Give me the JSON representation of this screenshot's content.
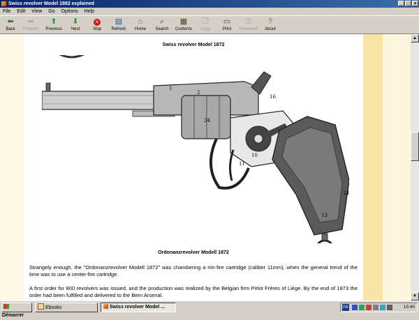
{
  "window": {
    "title": "Swiss revolver Model 1882 explained"
  },
  "menu": [
    "File",
    "Edit",
    "View",
    "Go",
    "Options",
    "Help"
  ],
  "toolbar": [
    {
      "label": "Back",
      "icon": "arrow-left-icon",
      "enabled": true
    },
    {
      "label": "Forward",
      "icon": "arrow-right-icon",
      "enabled": false
    },
    {
      "label": "Previous",
      "icon": "arrow-up-icon",
      "enabled": true
    },
    {
      "label": "Next",
      "icon": "arrow-down-icon",
      "enabled": true
    },
    {
      "label": "Stop",
      "icon": "stop-icon",
      "enabled": true
    },
    {
      "label": "Refresh",
      "icon": "refresh-icon",
      "enabled": true
    },
    {
      "label": "Home",
      "icon": "home-icon",
      "enabled": true
    },
    {
      "label": "Search",
      "icon": "search-icon",
      "enabled": true
    },
    {
      "label": "Contents",
      "icon": "contents-icon",
      "enabled": true
    },
    {
      "label": "Copy",
      "icon": "copy-icon",
      "enabled": false
    },
    {
      "label": "Print",
      "icon": "print-icon",
      "enabled": true
    },
    {
      "label": "Password",
      "icon": "key-icon",
      "enabled": false
    },
    {
      "label": "About",
      "icon": "about-icon",
      "enabled": true
    }
  ],
  "content": {
    "figure_title": "Swiss revolver Model 1872",
    "figure_caption": "Ordonanzrevolver Modell 1872",
    "figure_numbers": {
      "n1": "1",
      "n2": "2",
      "n3": "24",
      "n4": "16",
      "n5": "11",
      "n6": "21",
      "n7": "10",
      "n8": "13"
    },
    "paragraphs": [
      "Strangely enough, the \"Ordonanzrevolver Modell 1872\" was chambering a rim-fire cartridge (caliber 11mm), when the general trend of the time was to use a center-fire cartridge.",
      "A first order for 800 revolvers was issued, and the production was realized by the Belgian firm Pirlot Frères of Liège. By the end of 1873 the order had been fulfilled and delivered to the Bern Arsenal."
    ]
  },
  "taskbar": {
    "start_label": "Démarrer",
    "tasks": [
      {
        "label": "Ebooks",
        "active": false
      },
      {
        "label": "Swiss revolver Model ...",
        "active": true
      }
    ],
    "tray_lang": "FR",
    "clock": "15:40"
  },
  "colors": {
    "titlebar_start": "#0a246a",
    "titlebar_end": "#3a6ea5",
    "chrome": "#d4d0c8",
    "left_gutter": "#fef8e4",
    "right_band": "#f8e4a4",
    "right_band_light": "#fdf6dc"
  }
}
